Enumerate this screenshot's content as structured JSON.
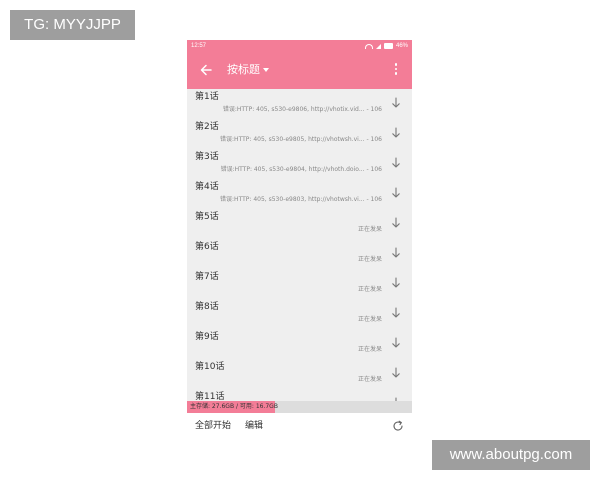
{
  "watermarks": {
    "top": "TG: MYYJJPP",
    "bottom": "www.aboutpg.com"
  },
  "status_bar": {
    "time": "12:57",
    "battery": "46%"
  },
  "app_bar": {
    "title": "按标题",
    "back_icon": "arrow-left-icon",
    "dropdown_icon": "caret-down-icon",
    "menu_icon": "more-vert-icon"
  },
  "chapters": [
    {
      "name": "第1话",
      "status": "错误:HTTP: 405, s530-e9806, http://vhotix.vid... - 106"
    },
    {
      "name": "第2话",
      "status": "错误:HTTP: 405, s530-e9805, http://vhotwsh.vi... - 106"
    },
    {
      "name": "第3话",
      "status": "错误:HTTP: 405, s530-e9804, http://vhoth.doio... - 106"
    },
    {
      "name": "第4话",
      "status": "错误:HTTP: 405, s530-e9803, http://vhotwsh.vi... - 106"
    },
    {
      "name": "第5话",
      "status": "正在发呆"
    },
    {
      "name": "第6话",
      "status": "正在发呆"
    },
    {
      "name": "第7话",
      "status": "正在发呆"
    },
    {
      "name": "第8话",
      "status": "正在发呆"
    },
    {
      "name": "第9话",
      "status": "正在发呆"
    },
    {
      "name": "第10话",
      "status": "正在发呆"
    },
    {
      "name": "第11话",
      "status": ""
    }
  ],
  "storage": {
    "text": "主存储: 27.6GB / 可用: 16.7GB",
    "used_fraction": 0.39
  },
  "bottom_bar": {
    "start_all": "全部开始",
    "edit": "编辑",
    "refresh_icon": "refresh-icon"
  },
  "colors": {
    "accent": "#f37d97",
    "list_background": "#efefef"
  }
}
